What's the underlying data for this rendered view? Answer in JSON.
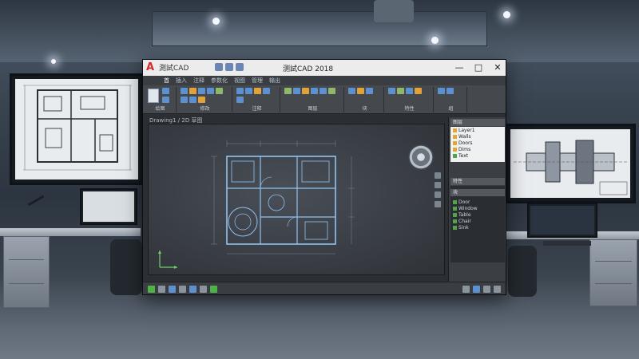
{
  "app": {
    "quick_access_title": "測試CAD",
    "window_title": "测試CAD 2018",
    "window_controls": [
      "—",
      "□",
      "✕"
    ],
    "logo": "A"
  },
  "ribbon": {
    "tabs": [
      "首",
      "插入",
      "注释",
      "参数化",
      "视图",
      "管理",
      "输出"
    ],
    "groups": [
      "绘图",
      "修改",
      "注释",
      "图层",
      "块",
      "特性",
      "组"
    ]
  },
  "document": {
    "tab_label": "Drawing1 / 2D 草图"
  },
  "side_panel": {
    "header_1": "图层",
    "layers": [
      {
        "name": "Layer1",
        "color": "#e0a82e"
      },
      {
        "name": "Walls",
        "color": "#e0a82e"
      },
      {
        "name": "Doors",
        "color": "#e0a82e"
      },
      {
        "name": "Dims",
        "color": "#e0a82e"
      },
      {
        "name": "Text",
        "color": "#55a24a"
      }
    ],
    "header_2": "特性",
    "header_3": "块",
    "blocks": [
      {
        "name": "Door",
        "color": "#55a24a"
      },
      {
        "name": "Window",
        "color": "#55a24a"
      },
      {
        "name": "Table",
        "color": "#55a24a"
      },
      {
        "name": "Chair",
        "color": "#55a24a"
      },
      {
        "name": "Sink",
        "color": "#55a24a"
      }
    ]
  },
  "colors": {
    "accent_blue": "#5d90cf",
    "accent_orange": "#e2a23a",
    "plan_lines": "#8fc3f2",
    "logo_red": "#d42a2a"
  },
  "icons": [
    "navigation-wheel-icon",
    "ucs-icon",
    "layer-swatch-icon"
  ]
}
